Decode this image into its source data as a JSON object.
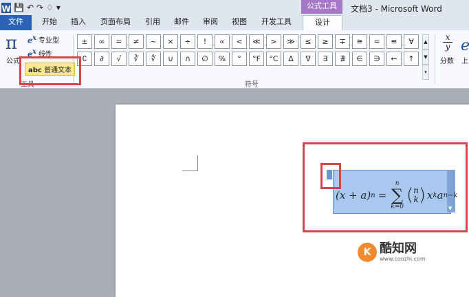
{
  "window": {
    "doc_title": "文档3 - Microsoft Word",
    "context_tab": "公式工具"
  },
  "tabs": [
    {
      "label": "文件"
    },
    {
      "label": "开始"
    },
    {
      "label": "插入"
    },
    {
      "label": "页面布局"
    },
    {
      "label": "引用"
    },
    {
      "label": "邮件"
    },
    {
      "label": "审阅"
    },
    {
      "label": "视图"
    },
    {
      "label": "开发工具"
    },
    {
      "label": "设计"
    }
  ],
  "tools": {
    "equation_label": "公式",
    "professional": "专业型",
    "linear": "线性",
    "normal_text": "普通文本",
    "normal_text_prefix": "abc",
    "group_label": "工具"
  },
  "symbols": {
    "group_label": "符号",
    "row1": [
      "±",
      "∞",
      "=",
      "≠",
      "~",
      "×",
      "÷",
      "!",
      "∝",
      "<",
      "≪",
      ">",
      "≫",
      "≤",
      "≥",
      "∓",
      "≅",
      "≈",
      "≡",
      "∀"
    ],
    "row2": [
      "∁",
      "∂",
      "√",
      "∛",
      "∜",
      "∪",
      "∩",
      "∅",
      "%",
      "°",
      "°F",
      "°C",
      "∆",
      "∇",
      "∃",
      "∄",
      "∈",
      "∋",
      "←",
      "↑"
    ]
  },
  "structures": {
    "fraction_label": "分数",
    "script_label": "上",
    "fraction_symbol_top": "x",
    "fraction_symbol_bottom": "y",
    "script_symbol": "e"
  },
  "equation": {
    "lhs": "(x + a)",
    "lhs_exp": "n",
    "equals": "=",
    "sum_upper": "n",
    "sum_lower": "k=0",
    "binom_top": "n",
    "binom_bottom": "k",
    "term1": "x",
    "term1_exp": "k",
    "term2": "a",
    "term2_exp": "n−k"
  },
  "watermark": {
    "title": "酷知网",
    "url": "www.coozhi.com",
    "logo": "K"
  },
  "colors": {
    "file_tab": "#2b62b4",
    "context_tab": "#a678c7",
    "highlight": "#d5454a",
    "equation_bg": "#a9c8ef"
  }
}
